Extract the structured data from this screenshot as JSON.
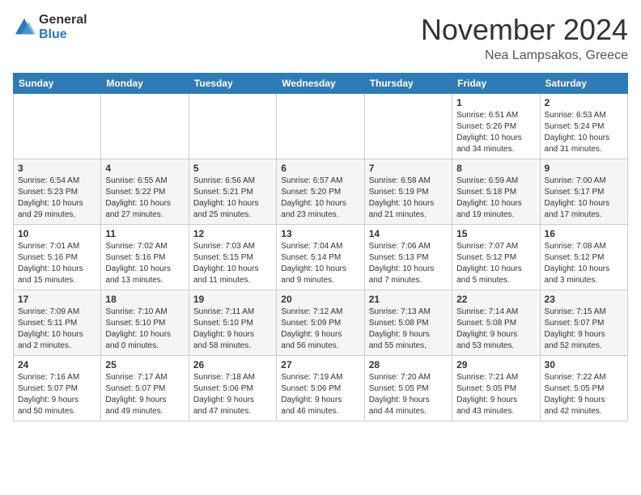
{
  "header": {
    "logo": {
      "general": "General",
      "blue": "Blue"
    },
    "title": "November 2024",
    "location": "Nea Lampsakos, Greece"
  },
  "weekdays": [
    "Sunday",
    "Monday",
    "Tuesday",
    "Wednesday",
    "Thursday",
    "Friday",
    "Saturday"
  ],
  "weeks": [
    [
      {
        "day": "",
        "info": ""
      },
      {
        "day": "",
        "info": ""
      },
      {
        "day": "",
        "info": ""
      },
      {
        "day": "",
        "info": ""
      },
      {
        "day": "",
        "info": ""
      },
      {
        "day": "1",
        "info": "Sunrise: 6:51 AM\nSunset: 5:26 PM\nDaylight: 10 hours\nand 34 minutes."
      },
      {
        "day": "2",
        "info": "Sunrise: 6:53 AM\nSunset: 5:24 PM\nDaylight: 10 hours\nand 31 minutes."
      }
    ],
    [
      {
        "day": "3",
        "info": "Sunrise: 6:54 AM\nSunset: 5:23 PM\nDaylight: 10 hours\nand 29 minutes."
      },
      {
        "day": "4",
        "info": "Sunrise: 6:55 AM\nSunset: 5:22 PM\nDaylight: 10 hours\nand 27 minutes."
      },
      {
        "day": "5",
        "info": "Sunrise: 6:56 AM\nSunset: 5:21 PM\nDaylight: 10 hours\nand 25 minutes."
      },
      {
        "day": "6",
        "info": "Sunrise: 6:57 AM\nSunset: 5:20 PM\nDaylight: 10 hours\nand 23 minutes."
      },
      {
        "day": "7",
        "info": "Sunrise: 6:58 AM\nSunset: 5:19 PM\nDaylight: 10 hours\nand 21 minutes."
      },
      {
        "day": "8",
        "info": "Sunrise: 6:59 AM\nSunset: 5:18 PM\nDaylight: 10 hours\nand 19 minutes."
      },
      {
        "day": "9",
        "info": "Sunrise: 7:00 AM\nSunset: 5:17 PM\nDaylight: 10 hours\nand 17 minutes."
      }
    ],
    [
      {
        "day": "10",
        "info": "Sunrise: 7:01 AM\nSunset: 5:16 PM\nDaylight: 10 hours\nand 15 minutes."
      },
      {
        "day": "11",
        "info": "Sunrise: 7:02 AM\nSunset: 5:16 PM\nDaylight: 10 hours\nand 13 minutes."
      },
      {
        "day": "12",
        "info": "Sunrise: 7:03 AM\nSunset: 5:15 PM\nDaylight: 10 hours\nand 11 minutes."
      },
      {
        "day": "13",
        "info": "Sunrise: 7:04 AM\nSunset: 5:14 PM\nDaylight: 10 hours\nand 9 minutes."
      },
      {
        "day": "14",
        "info": "Sunrise: 7:06 AM\nSunset: 5:13 PM\nDaylight: 10 hours\nand 7 minutes."
      },
      {
        "day": "15",
        "info": "Sunrise: 7:07 AM\nSunset: 5:12 PM\nDaylight: 10 hours\nand 5 minutes."
      },
      {
        "day": "16",
        "info": "Sunrise: 7:08 AM\nSunset: 5:12 PM\nDaylight: 10 hours\nand 3 minutes."
      }
    ],
    [
      {
        "day": "17",
        "info": "Sunrise: 7:09 AM\nSunset: 5:11 PM\nDaylight: 10 hours\nand 2 minutes."
      },
      {
        "day": "18",
        "info": "Sunrise: 7:10 AM\nSunset: 5:10 PM\nDaylight: 10 hours\nand 0 minutes."
      },
      {
        "day": "19",
        "info": "Sunrise: 7:11 AM\nSunset: 5:10 PM\nDaylight: 9 hours\nand 58 minutes."
      },
      {
        "day": "20",
        "info": "Sunrise: 7:12 AM\nSunset: 5:09 PM\nDaylight: 9 hours\nand 56 minutes."
      },
      {
        "day": "21",
        "info": "Sunrise: 7:13 AM\nSunset: 5:08 PM\nDaylight: 9 hours\nand 55 minutes."
      },
      {
        "day": "22",
        "info": "Sunrise: 7:14 AM\nSunset: 5:08 PM\nDaylight: 9 hours\nand 53 minutes."
      },
      {
        "day": "23",
        "info": "Sunrise: 7:15 AM\nSunset: 5:07 PM\nDaylight: 9 hours\nand 52 minutes."
      }
    ],
    [
      {
        "day": "24",
        "info": "Sunrise: 7:16 AM\nSunset: 5:07 PM\nDaylight: 9 hours\nand 50 minutes."
      },
      {
        "day": "25",
        "info": "Sunrise: 7:17 AM\nSunset: 5:07 PM\nDaylight: 9 hours\nand 49 minutes."
      },
      {
        "day": "26",
        "info": "Sunrise: 7:18 AM\nSunset: 5:06 PM\nDaylight: 9 hours\nand 47 minutes."
      },
      {
        "day": "27",
        "info": "Sunrise: 7:19 AM\nSunset: 5:06 PM\nDaylight: 9 hours\nand 46 minutes."
      },
      {
        "day": "28",
        "info": "Sunrise: 7:20 AM\nSunset: 5:05 PM\nDaylight: 9 hours\nand 44 minutes."
      },
      {
        "day": "29",
        "info": "Sunrise: 7:21 AM\nSunset: 5:05 PM\nDaylight: 9 hours\nand 43 minutes."
      },
      {
        "day": "30",
        "info": "Sunrise: 7:22 AM\nSunset: 5:05 PM\nDaylight: 9 hours\nand 42 minutes."
      }
    ]
  ]
}
